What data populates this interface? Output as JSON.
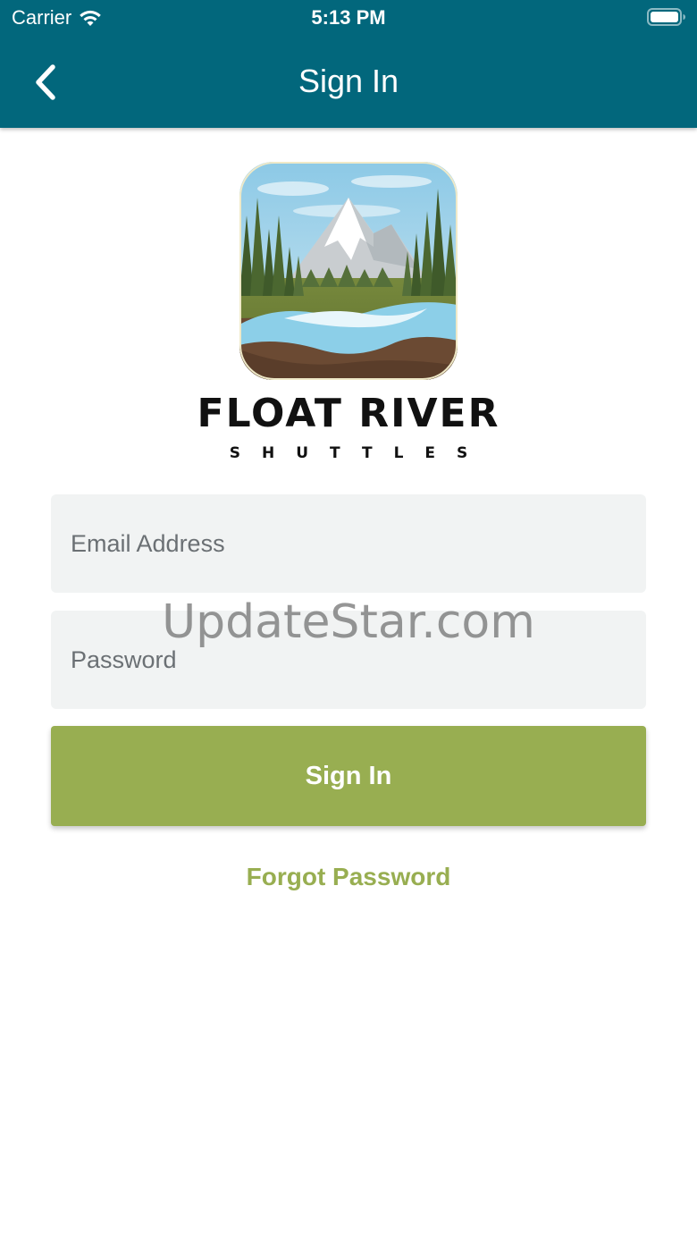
{
  "status_bar": {
    "carrier": "Carrier",
    "time": "5:13 PM",
    "wifi_icon": "wifi-icon",
    "battery_icon": "battery-icon"
  },
  "nav": {
    "title": "Sign In",
    "back_icon": "chevron-left-icon"
  },
  "brand": {
    "logo_icon": "mountain-river-logo",
    "name": "FLOAT RIVER",
    "tagline": "SHUTTLES"
  },
  "form": {
    "email_placeholder": "Email Address",
    "email_value": "",
    "password_placeholder": "Password",
    "password_value": "",
    "submit_label": "Sign In",
    "forgot_label": "Forgot Password"
  },
  "watermark": "UpdateStar.com",
  "colors": {
    "header": "#02677c",
    "accent": "#98ae51",
    "field_bg": "#f1f3f3"
  }
}
